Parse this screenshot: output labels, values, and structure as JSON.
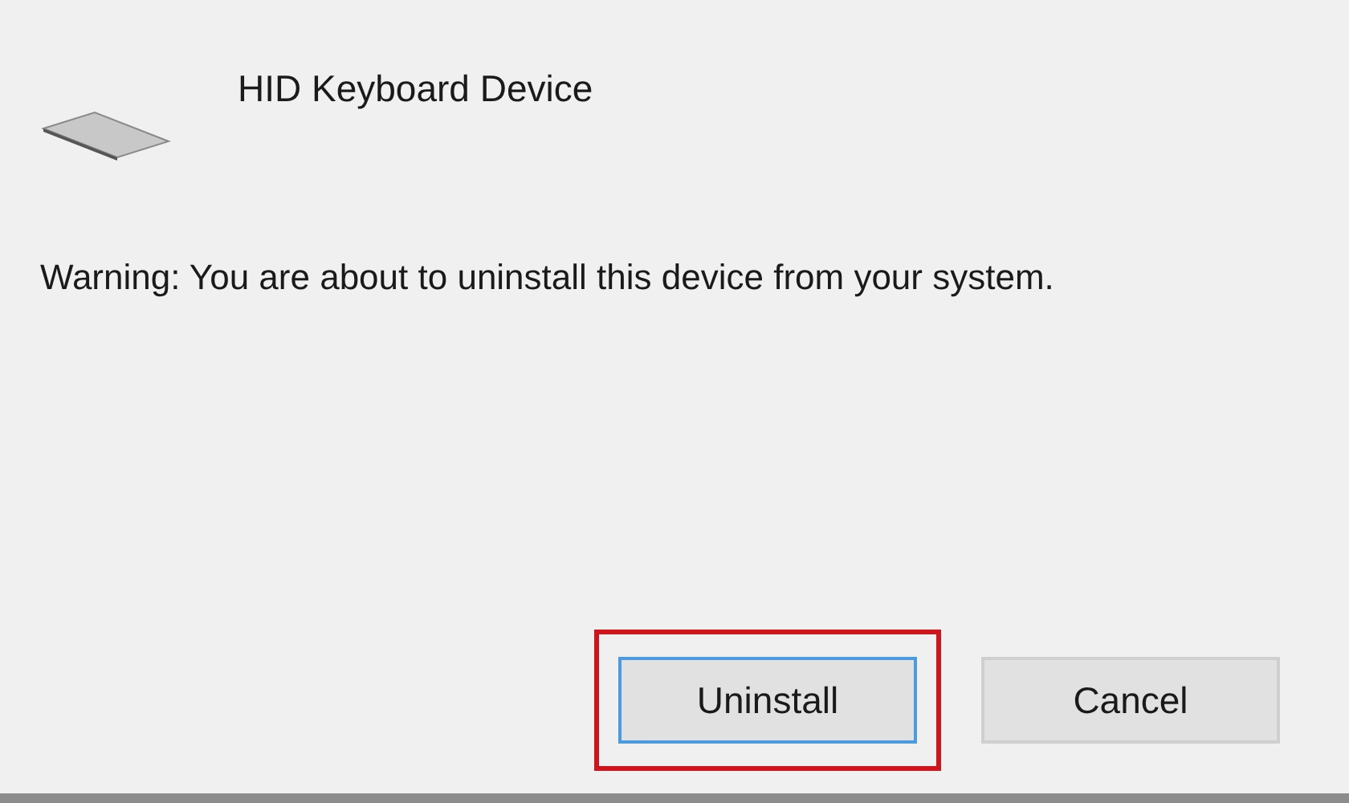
{
  "device": {
    "name": "HID Keyboard Device"
  },
  "message": "Warning: You are about to uninstall this device from your system.",
  "buttons": [
    {
      "label": "Uninstall",
      "focused": true,
      "highlighted": true
    },
    {
      "label": "Cancel",
      "focused": false,
      "highlighted": false
    }
  ]
}
